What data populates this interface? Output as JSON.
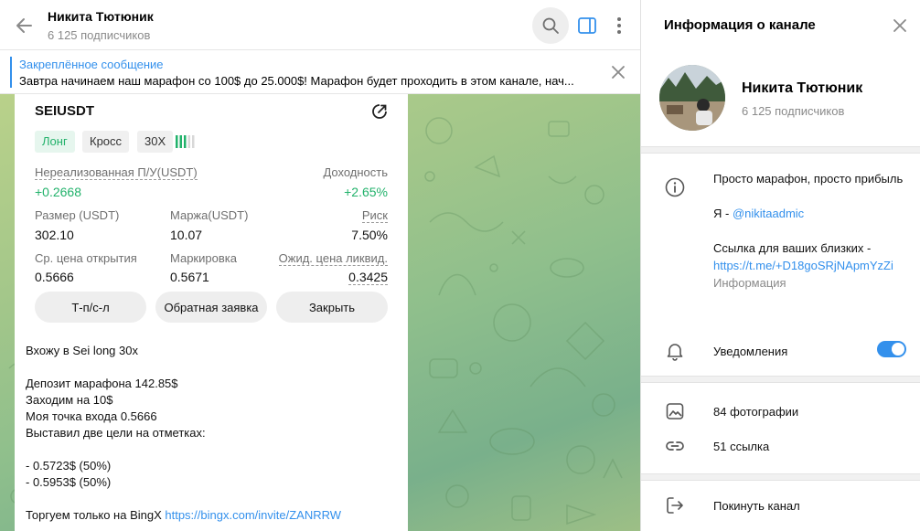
{
  "header": {
    "title": "Никита Тютюник",
    "subtitle": "6 125 подписчиков"
  },
  "pinned": {
    "title": "Закреплённое сообщение",
    "text": "Завтра начинаем наш марафон со 100$ до 25.000$!  Марафон будет проходить в этом канале, нач..."
  },
  "card": {
    "symbol": "SEIUSDT",
    "tag_long": "Лонг",
    "tag_cross": "Кросс",
    "tag_leverage": "30X",
    "pnl_label": "Нереализованная П/У(USDT)",
    "pnl_value": "+0.2668",
    "roi_label": "Доходность",
    "roi_value": "+2.65%",
    "size_label": "Размер (USDT)",
    "size_value": "302.10",
    "margin_label": "Маржа(USDT)",
    "margin_value": "10.07",
    "risk_label": "Риск",
    "risk_value": "7.50%",
    "entry_label": "Ср. цена открытия",
    "entry_value": "0.5666",
    "mark_label": "Маркировка",
    "mark_value": "0.5671",
    "liq_label": "Ожид. цена ликвид.",
    "liq_value": "0.3425",
    "btn_tpsl": "Т-п/с-л",
    "btn_reverse": "Обратная заявка",
    "btn_close": "Закрыть"
  },
  "message": {
    "text": "Вхожу в Sei long 30x\n\nДепозит марафона 142.85$\nЗаходим на 10$\nМоя точка входа 0.5666\nВыставил две цели на отметках:\n\n- 0.5723$ (50%)\n- 0.5953$ (50%)\n\nТоргуем только на BingX ",
    "link": "https://bingx.com/invite/ZANRRW"
  },
  "info": {
    "title": "Информация о канале",
    "channel_name": "Никита Тютюник",
    "channel_sub": "6 125 подписчиков",
    "desc_line1": "Просто марафон, просто прибыль",
    "desc_contact_prefix": "Я - ",
    "desc_contact_link": "@nikitaadmic",
    "desc_link_label": "Ссылка для ваших близких -",
    "desc_link": "https://t.me/+D18goSRjNApmYzZi",
    "desc_caption": "Информация",
    "notifications": "Уведомления",
    "notifications_on": true,
    "photos": "84 фотографии",
    "links": "51 ссылка",
    "leave": "Покинуть канал"
  },
  "colors": {
    "accent": "#3390ec",
    "profit": "#22b26b"
  }
}
